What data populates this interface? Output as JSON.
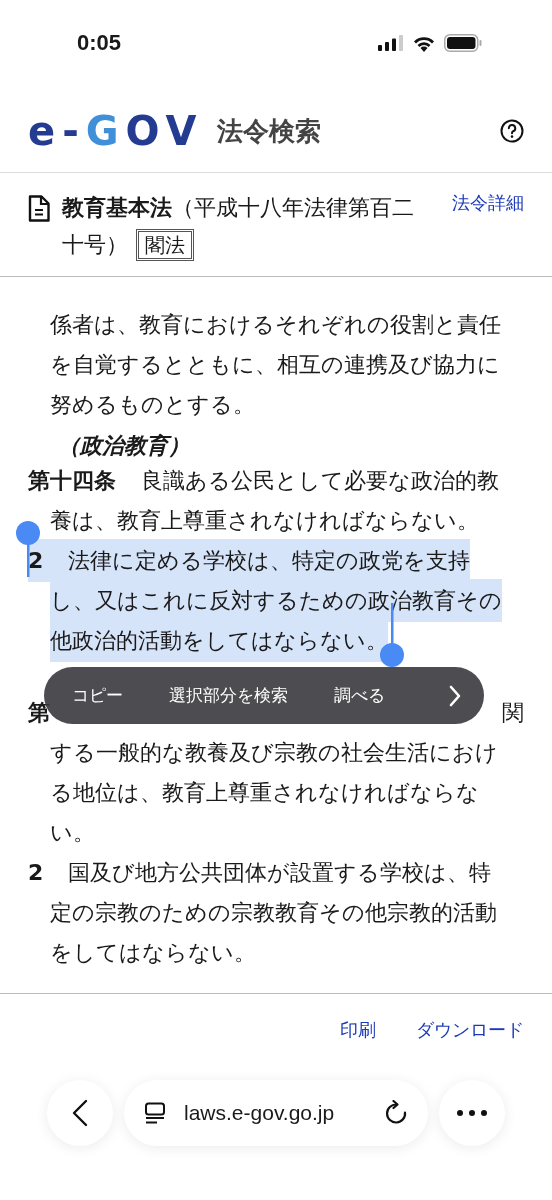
{
  "status_bar": {
    "time": "0:05"
  },
  "header": {
    "logo": [
      {
        "text": "e-",
        "color": "#233c91"
      },
      {
        "text": "G",
        "color": "#3f90d8"
      },
      {
        "text": "OV",
        "color": "#233c91"
      }
    ],
    "title": "法令検索"
  },
  "law": {
    "title": "**教育基本法**（平成十八年法律第百二十号）",
    "badge": "閣法",
    "detail_link": "法令詳細"
  },
  "content": [
    {
      "kind": "continuation",
      "lines": [
        "係者は、教育におけるそれぞれの役割と責任",
        "を自覚するとともに、相互の連携及び協力に",
        "努めるものとする。"
      ]
    },
    {
      "kind": "caption",
      "text": "（政治教育）"
    },
    {
      "kind": "article",
      "number": "第十四条",
      "lines": [
        "良識ある公民として必要な政治的教",
        "養は、教育上尊重されなければならない。"
      ],
      "selected": false
    },
    {
      "kind": "article",
      "number": "2",
      "lines": [
        "法律に定める学校は、特定の政党を支持",
        "し、又はこれに反対するための政治教育その",
        "他政治的活動をしてはならない。"
      ],
      "selected": true
    },
    {
      "kind": "covered_row",
      "start": "第",
      "end": "関"
    },
    {
      "kind": "continuation",
      "lines": [
        "する一般的な教養及び宗教の社会生活におけ",
        "る地位は、教育上尊重されなければならな",
        "い。"
      ]
    },
    {
      "kind": "article",
      "number": "2",
      "lines": [
        "国及び地方公共団体が設置する学校は、特",
        "定の宗教のための宗教教育その他宗教的活動",
        "をしてはならない。"
      ],
      "selected": false
    }
  ],
  "selection_menu": {
    "items": [
      "コピー",
      "選択部分を検索",
      "調べる"
    ]
  },
  "footer_links": [
    "印刷",
    "ダウンロード"
  ],
  "browser_bar": {
    "url": "laws.e-gov.go.jp"
  }
}
